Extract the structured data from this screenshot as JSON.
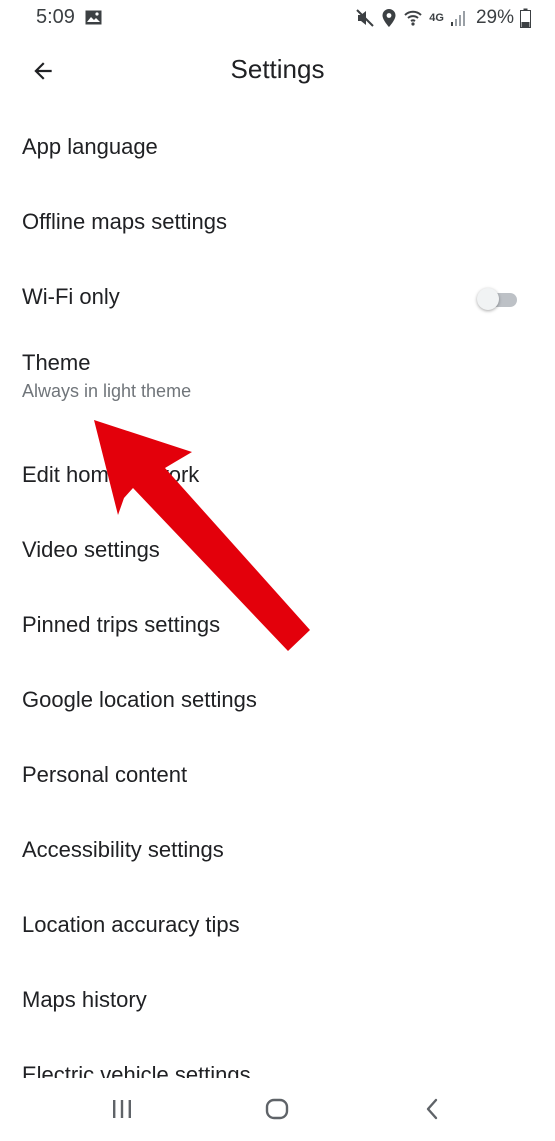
{
  "status_bar": {
    "time": "5:09",
    "network_label": "4G",
    "battery_percent": "29%",
    "icons": [
      "gallery-icon",
      "mute-icon",
      "location-icon",
      "wifi-icon",
      "signal-icon",
      "battery-icon"
    ]
  },
  "header": {
    "title": "Settings",
    "back_icon": "arrow-left-icon"
  },
  "settings": [
    {
      "label": "App language"
    },
    {
      "label": "Offline maps settings"
    },
    {
      "label": "Wi-Fi only",
      "toggle": false
    },
    {
      "label": "Theme",
      "sublabel": "Always in light theme"
    },
    {
      "label": "Edit home or work"
    },
    {
      "label": "Video settings"
    },
    {
      "label": "Pinned trips settings"
    },
    {
      "label": "Google location settings"
    },
    {
      "label": "Personal content"
    },
    {
      "label": "Accessibility settings"
    },
    {
      "label": "Location accuracy tips"
    },
    {
      "label": "Maps history"
    },
    {
      "label": "Electric vehicle settings"
    }
  ],
  "nav_bar": {
    "icons": [
      "recent-apps-icon",
      "home-icon",
      "back-icon"
    ]
  },
  "colors": {
    "text_primary": "#202124",
    "text_secondary": "#70757a",
    "annotation_arrow": "#e3000b",
    "toggle_off_track": "#bdc1c6"
  }
}
